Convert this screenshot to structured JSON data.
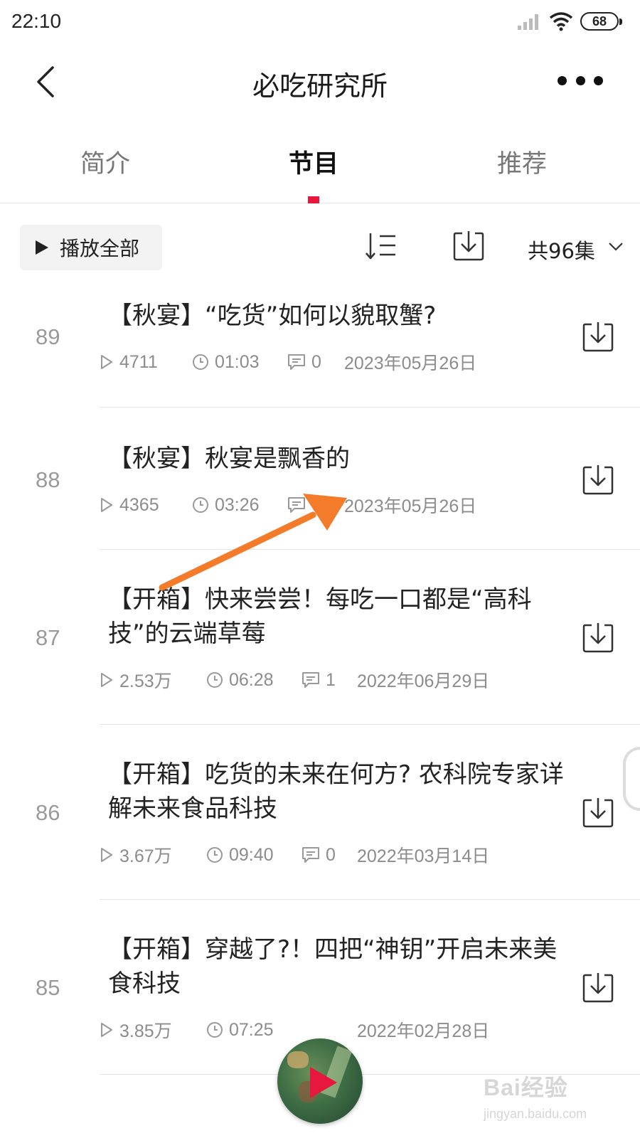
{
  "status_bar": {
    "time": "22:10",
    "battery": "68"
  },
  "header": {
    "title": "必吃研究所"
  },
  "tabs": [
    {
      "label": "简介"
    },
    {
      "label": "节目"
    },
    {
      "label": "推荐"
    }
  ],
  "active_tab": "节目",
  "toolbar": {
    "play_all_label": "播放全部",
    "episode_count": "共96集"
  },
  "episodes": [
    {
      "number": "89",
      "title": "【秋宴】“吃货”如何以貌取蟹?",
      "plays": "4711",
      "duration": "01:03",
      "comments": "0",
      "date": "2023年05月26日"
    },
    {
      "number": "88",
      "title": "【秋宴】秋宴是飘香的",
      "plays": "4365",
      "duration": "03:26",
      "comments": "0",
      "date": "2023年05月26日"
    },
    {
      "number": "87",
      "title": "【开箱】快来尝尝！每吃一口都是“高科技”的云端草莓",
      "plays": "2.53万",
      "duration": "06:28",
      "comments": "1",
      "date": "2022年06月29日"
    },
    {
      "number": "86",
      "title": "【开箱】吃货的未来在何方? 农科院专家详解未来食品科技",
      "plays": "3.67万",
      "duration": "09:40",
      "comments": "0",
      "date": "2022年03月14日"
    },
    {
      "number": "85",
      "title": "【开箱】穿越了?！四把“神钥”开启未来美食科技",
      "plays": "3.85万",
      "duration": "07:25",
      "comments": "",
      "date": "2022年02月28日"
    }
  ],
  "watermark": {
    "main": "Bai经验",
    "sub": "jingyan.baidu.com"
  },
  "colors": {
    "accent": "#e8173d",
    "annotation": "#f47b2a",
    "text": "#222222",
    "muted": "#8c8c8c"
  }
}
